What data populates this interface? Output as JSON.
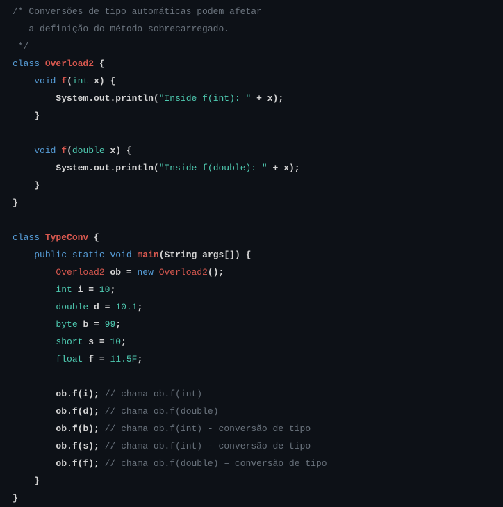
{
  "code": {
    "comment_l1": "/* Conversões de tipo automáticas podem afetar",
    "comment_l2": "   a definição do método sobrecarregado.",
    "comment_l3": " */",
    "kw_class": "class",
    "kw_void": "void",
    "kw_public": "public",
    "kw_static": "static",
    "kw_new": "new",
    "cls_overload2": "Overload2",
    "cls_typeconv": "TypeConv",
    "m_f": "f",
    "m_main": "main",
    "m_println": "println",
    "t_int": "int",
    "t_double": "double",
    "t_byte": "byte",
    "t_short": "short",
    "t_float": "float",
    "t_string": "String",
    "id_system": "System",
    "id_out": "out",
    "id_x": "x",
    "id_args": "args",
    "id_ob": "ob",
    "id_i": "i",
    "id_d": "d",
    "id_b": "b",
    "id_s": "s",
    "id_ff": "f",
    "str_inside_int": "\"Inside f(int): \"",
    "str_inside_double": "\"Inside f(double): \"",
    "num_10": "10",
    "num_10_1": "10.1",
    "num_99": "99",
    "num_11_5F": "11.5F",
    "cm_int": "// chama ob.f(int)",
    "cm_double": "// chama ob.f(double)",
    "cm_int_conv": "// chama ob.f(int) - conversão de tipo",
    "cm_double_conv": "// chama ob.f(double) – conversão de tipo",
    "p_obrace": " {",
    "p_cbrace": "}",
    "p_open": "(",
    "p_close": ")",
    "p_closebrace": ") {",
    "p_semi": ";",
    "p_dot": ".",
    "p_eq": " = ",
    "p_plus": " + ",
    "p_brackets": "[]",
    "p_openparen_close": "();",
    "p_close_semi": ");",
    "p_close_semi_sp": "); ",
    "p_sp": " "
  }
}
